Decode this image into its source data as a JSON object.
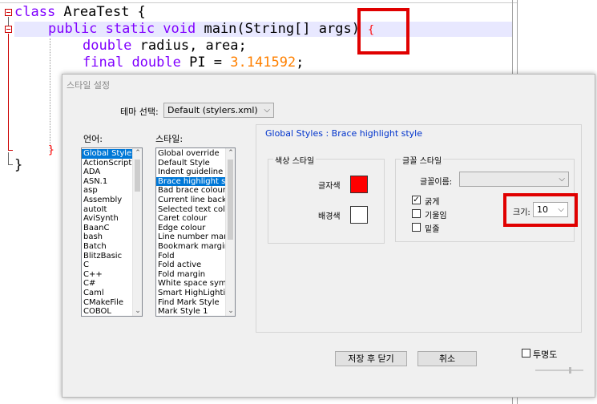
{
  "editor": {
    "line1_kw": "class",
    "line1_rest": " AreaTest {",
    "line2_kw": "public static void",
    "line2_rest": " main(String[] args) ",
    "line2_brace": "{",
    "line3": "double radius, area;",
    "line3_kw": "double",
    "line3_rest": " radius, area;",
    "line4_kw1": "final",
    "line4_kw2": "double",
    "line4_rest": " PI = ",
    "line4_num": "3.141592",
    "line4_end": ";",
    "line_close_inner": "}",
    "line_close_outer": "}"
  },
  "dialog": {
    "title": "스타일 설정",
    "theme_label": "테마 선택:",
    "theme_value": "Default (stylers.xml)",
    "language_label": "언어:",
    "style_label": "스타일:",
    "languages": [
      "Global Styles",
      "ActionScript",
      "ADA",
      "ASN.1",
      "asp",
      "Assembly",
      "autoIt",
      "AviSynth",
      "BaanC",
      "bash",
      "Batch",
      "BlitzBasic",
      "C",
      "C++",
      "C#",
      "Caml",
      "CMakeFile",
      "COBOL"
    ],
    "styles": [
      "Global override",
      "Default Style",
      "Indent guideline style",
      "Brace highlight style",
      "Bad brace colour",
      "Current line background",
      "Selected text colour",
      "Caret colour",
      "Edge colour",
      "Line number margin",
      "Bookmark margin",
      "Fold",
      "Fold active",
      "Fold margin",
      "White space symbol",
      "Smart HighLighting",
      "Find Mark Style",
      "Mark Style 1"
    ],
    "panel_title": "Global Styles : Brace highlight style",
    "color_group": "색상 스타일",
    "fg_label": "글자색",
    "bg_label": "배경색",
    "fg_color": "#ff0000",
    "bg_color": "#ffffff",
    "font_group": "글꼴 스타일",
    "font_name_label": "글꼴이름:",
    "font_name_value": "",
    "bold_label": "굵게",
    "italic_label": "기울임",
    "underline_label": "밑줄",
    "bold_checked": "✓",
    "size_label": "크기:",
    "size_value": "10",
    "save_close": "저장 후 닫기",
    "cancel": "취소",
    "transparency": "투명도"
  }
}
